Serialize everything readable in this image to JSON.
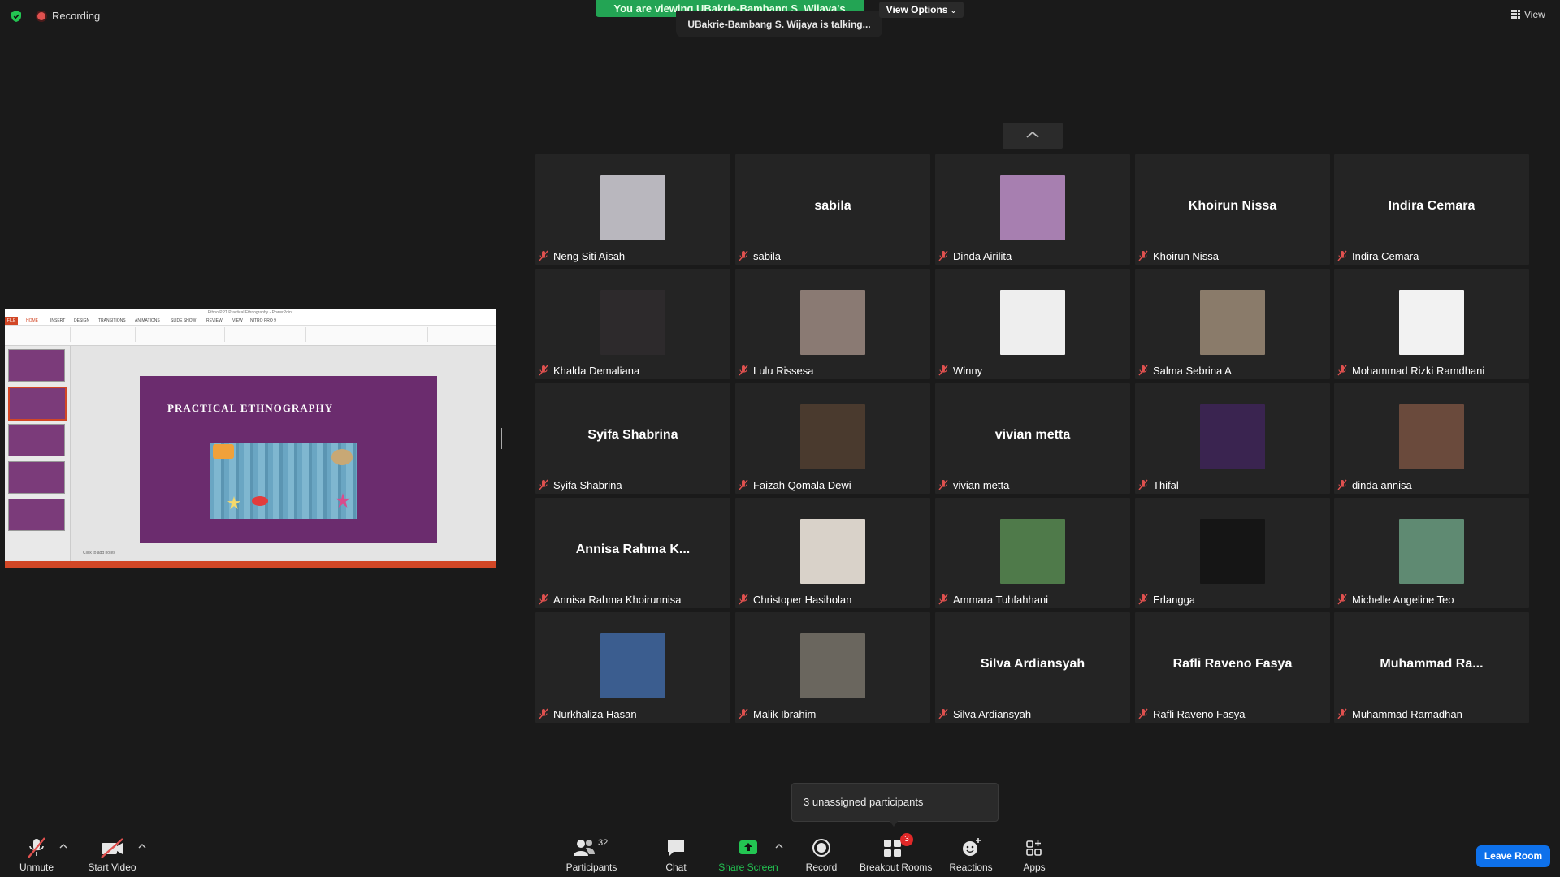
{
  "top": {
    "recording_label": "Recording",
    "viewing_banner": "You are viewing UBakrie-Bambang S. Wijaya's screen",
    "view_options_label": "View Options",
    "talking_text": "UBakrie-Bambang S. Wijaya is talking...",
    "view_label": "View"
  },
  "shared_screen": {
    "window_title": "Ethno PPT Practical Ethnography - PowerPoint",
    "file_tab": "FILE",
    "tabs": [
      "HOME",
      "INSERT",
      "DESIGN",
      "TRANSITIONS",
      "ANIMATIONS",
      "SLIDE SHOW",
      "REVIEW",
      "VIEW",
      "NITRO PRO 9"
    ],
    "slide_title": "PRACTICAL ETHNOGRAPHY",
    "notes_placeholder": "Click to add notes"
  },
  "tiles": [
    {
      "name": "Neng Siti Aisah",
      "display": "photo",
      "photo_color": "#b9b7be"
    },
    {
      "name": "sabila",
      "display": "text",
      "big_text": "sabila"
    },
    {
      "name": "Dinda Airilita",
      "display": "photo",
      "photo_color": "#a77fb0"
    },
    {
      "name": "Khoirun Nissa",
      "display": "text",
      "big_text": "Khoirun Nissa"
    },
    {
      "name": "Indira Cemara",
      "display": "text",
      "big_text": "Indira Cemara"
    },
    {
      "name": "Khalda Demaliana",
      "display": "photo",
      "photo_color": "#2d2a2c"
    },
    {
      "name": "Lulu Rissesa",
      "display": "photo",
      "photo_color": "#8a7a73"
    },
    {
      "name": "Winny",
      "display": "photo",
      "photo_color": "#eeeeee"
    },
    {
      "name": "Salma Sebrina A",
      "display": "photo",
      "photo_color": "#8a7b6a"
    },
    {
      "name": "Mohammad Rizki Ramdhani",
      "display": "photo",
      "photo_color": "#f2f2f2"
    },
    {
      "name": "Syifa Shabrina",
      "display": "text",
      "big_text": "Syifa Shabrina"
    },
    {
      "name": "Faizah Qomala Dewi",
      "display": "photo",
      "photo_color": "#4a3a2e"
    },
    {
      "name": "vivian metta",
      "display": "text",
      "big_text": "vivian metta"
    },
    {
      "name": "Thifal",
      "display": "photo",
      "photo_color": "#3a2450"
    },
    {
      "name": "dinda annisa",
      "display": "photo",
      "photo_color": "#6a4a3c"
    },
    {
      "name": "Annisa Rahma Khoirunnisa",
      "display": "text",
      "big_text": "Annisa  Rahma  K..."
    },
    {
      "name": "Christoper Hasiholan",
      "display": "photo",
      "photo_color": "#d9d2c9"
    },
    {
      "name": "Ammara Tuhfahhani",
      "display": "photo",
      "photo_color": "#4f7a4a"
    },
    {
      "name": "Erlangga",
      "display": "photo",
      "photo_color": "#151515"
    },
    {
      "name": "Michelle Angeline Teo",
      "display": "photo",
      "photo_color": "#5f8a72"
    },
    {
      "name": "Nurkhaliza Hasan",
      "display": "photo",
      "photo_color": "#3b5d8f"
    },
    {
      "name": "Malik Ibrahim",
      "display": "photo",
      "photo_color": "#6a665e"
    },
    {
      "name": "Silva Ardiansyah",
      "display": "text",
      "big_text": "Silva Ardiansyah"
    },
    {
      "name": "Rafli Raveno Fasya",
      "display": "text",
      "big_text": "Rafli Raveno Fasya"
    },
    {
      "name": "Muhammad Ramadhan",
      "display": "text",
      "big_text": "Muhammad  Ra..."
    }
  ],
  "unassigned_text": "3 unassigned participants",
  "toolbar": {
    "unmute": "Unmute",
    "start_video": "Start Video",
    "participants": "Participants",
    "participants_count": "32",
    "chat": "Chat",
    "share_screen": "Share Screen",
    "record": "Record",
    "breakout_rooms": "Breakout Rooms",
    "breakout_badge": "3",
    "reactions": "Reactions",
    "apps": "Apps",
    "leave_room": "Leave Room"
  },
  "colors": {
    "share_green": "#23c552",
    "leave_blue": "#0e71eb",
    "muted_red": "#e0514f",
    "background": "#1a1a1a"
  }
}
